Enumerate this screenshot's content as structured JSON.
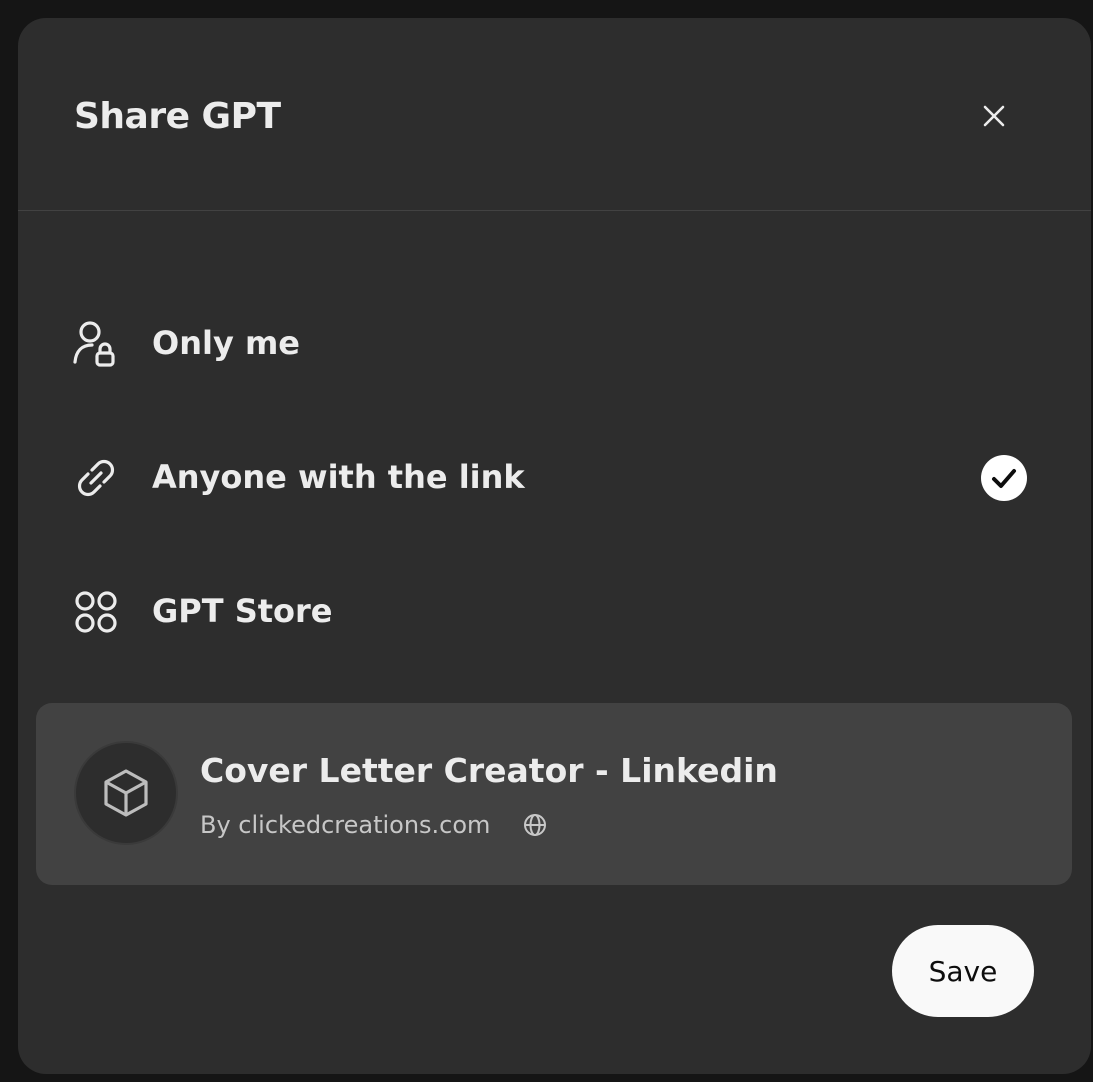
{
  "dialog": {
    "title": "Share GPT",
    "close_icon": "close-icon"
  },
  "share_options": [
    {
      "label": "Only me",
      "icon": "person-lock-icon",
      "selected": false
    },
    {
      "label": "Anyone with the link",
      "icon": "link-icon",
      "selected": true
    },
    {
      "label": "GPT Store",
      "icon": "apps-grid-icon",
      "selected": false
    }
  ],
  "gpt": {
    "name": "Cover Letter Creator - Linkedin",
    "author": "By clickedcreations.com",
    "avatar_icon": "cube-icon",
    "visibility_icon": "globe-icon"
  },
  "footer": {
    "save_label": "Save"
  },
  "colors": {
    "modal_bg": "#2d2d2d",
    "card_bg": "#424242",
    "text_primary": "#ececec",
    "text_secondary": "#c7c7c7",
    "button_bg": "#f9f9f9"
  }
}
